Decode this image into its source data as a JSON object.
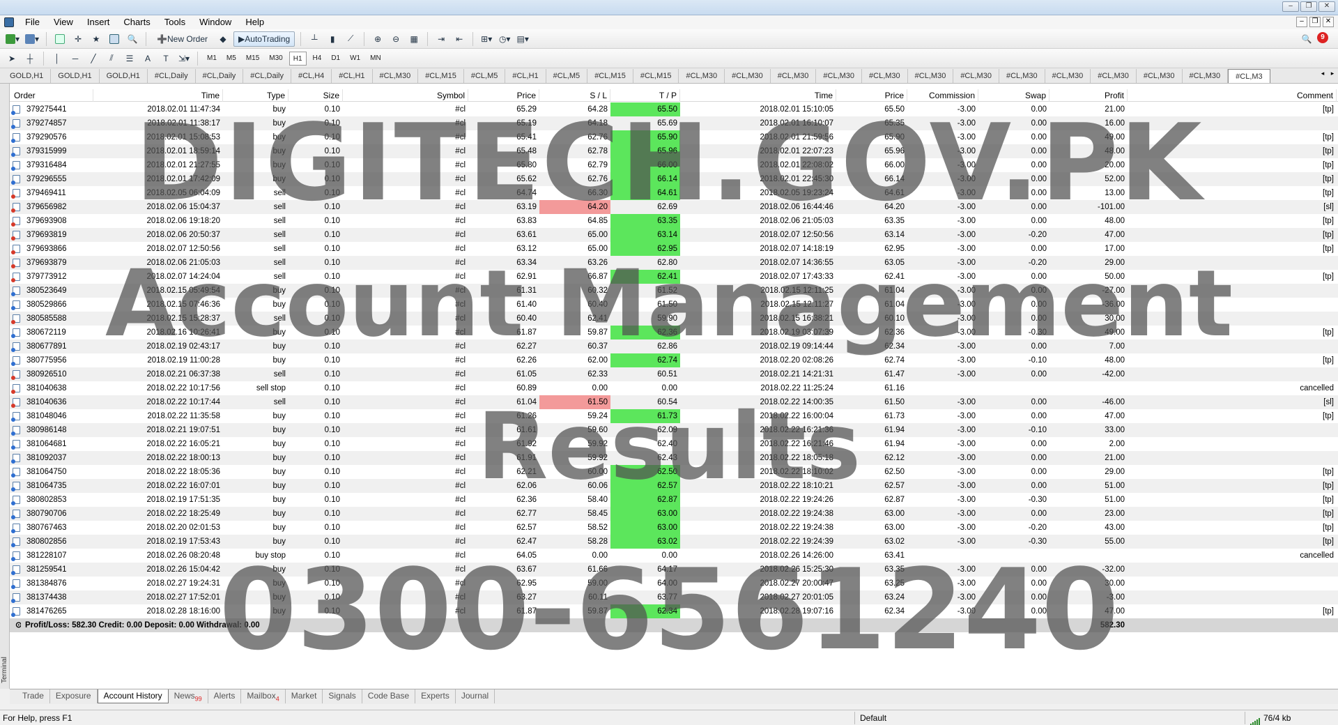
{
  "menu": [
    "File",
    "View",
    "Insert",
    "Charts",
    "Tools",
    "Window",
    "Help"
  ],
  "toolbar": {
    "new_order": "New Order",
    "autotrading": "AutoTrading",
    "notifications": "9"
  },
  "timeframes": [
    "M1",
    "M5",
    "M15",
    "M30",
    "H1",
    "H4",
    "D1",
    "W1",
    "MN"
  ],
  "active_timeframe": "H1",
  "chart_tabs": [
    "GOLD,H1",
    "GOLD,H1",
    "GOLD,H1",
    "#CL,Daily",
    "#CL,Daily",
    "#CL,Daily",
    "#CL,H4",
    "#CL,H1",
    "#CL,M30",
    "#CL,M15",
    "#CL,M5",
    "#CL,H1",
    "#CL,M5",
    "#CL,M15",
    "#CL,M15",
    "#CL,M30",
    "#CL,M30",
    "#CL,M30",
    "#CL,M30",
    "#CL,M30",
    "#CL,M30",
    "#CL,M30",
    "#CL,M30",
    "#CL,M30",
    "#CL,M30",
    "#CL,M30",
    "#CL,M30",
    "#CL,M3"
  ],
  "columns": [
    "Order",
    "Time",
    "Type",
    "Size",
    "Symbol",
    "Price",
    "S / L",
    "T / P",
    "Time",
    "Price",
    "Commission",
    "Swap",
    "Profit",
    "Comment"
  ],
  "rows": [
    {
      "order": "379275441",
      "time": "2018.02.01 11:47:34",
      "type": "buy",
      "size": "0.10",
      "symbol": "#cl",
      "price": "65.29",
      "sl": "64.28",
      "tp": "65.50",
      "ctime": "2018.02.01 15:10:05",
      "cprice": "65.50",
      "commission": "-3.00",
      "swap": "0.00",
      "profit": "21.00",
      "comment": "[tp]",
      "hl": "tp"
    },
    {
      "order": "379274857",
      "time": "2018.02.01 11:38:17",
      "type": "buy",
      "size": "0.10",
      "symbol": "#cl",
      "price": "65.19",
      "sl": "64.18",
      "tp": "65.69",
      "ctime": "2018.02.01 16:10:07",
      "cprice": "65.35",
      "commission": "-3.00",
      "swap": "0.00",
      "profit": "16.00",
      "comment": "",
      "hl": ""
    },
    {
      "order": "379290576",
      "time": "2018.02.01 15:08:53",
      "type": "buy",
      "size": "0.10",
      "symbol": "#cl",
      "price": "65.41",
      "sl": "62.76",
      "tp": "65.90",
      "ctime": "2018.02.01 21:59:56",
      "cprice": "65.90",
      "commission": "-3.00",
      "swap": "0.00",
      "profit": "49.00",
      "comment": "[tp]",
      "hl": "tp"
    },
    {
      "order": "379315999",
      "time": "2018.02.01 18:59:14",
      "type": "buy",
      "size": "0.10",
      "symbol": "#cl",
      "price": "65.48",
      "sl": "62.78",
      "tp": "65.96",
      "ctime": "2018.02.01 22:07:23",
      "cprice": "65.96",
      "commission": "-3.00",
      "swap": "0.00",
      "profit": "48.00",
      "comment": "[tp]",
      "hl": "tp"
    },
    {
      "order": "379316484",
      "time": "2018.02.01 21:27:55",
      "type": "buy",
      "size": "0.10",
      "symbol": "#cl",
      "price": "65.80",
      "sl": "62.79",
      "tp": "66.00",
      "ctime": "2018.02.01 22:08:02",
      "cprice": "66.00",
      "commission": "-3.00",
      "swap": "0.00",
      "profit": "20.00",
      "comment": "[tp]",
      "hl": "tp"
    },
    {
      "order": "379296555",
      "time": "2018.02.01 17:42:09",
      "type": "buy",
      "size": "0.10",
      "symbol": "#cl",
      "price": "65.62",
      "sl": "62.76",
      "tp": "66.14",
      "ctime": "2018.02.01 22:45:30",
      "cprice": "66.14",
      "commission": "-3.00",
      "swap": "0.00",
      "profit": "52.00",
      "comment": "[tp]",
      "hl": "tp"
    },
    {
      "order": "379469411",
      "time": "2018.02.05 06:04:09",
      "type": "sell",
      "size": "0.10",
      "symbol": "#cl",
      "price": "64.74",
      "sl": "66.30",
      "tp": "64.61",
      "ctime": "2018.02.05 19:23:24",
      "cprice": "64.61",
      "commission": "-3.00",
      "swap": "0.00",
      "profit": "13.00",
      "comment": "[tp]",
      "hl": "tp"
    },
    {
      "order": "379656982",
      "time": "2018.02.06 15:04:37",
      "type": "sell",
      "size": "0.10",
      "symbol": "#cl",
      "price": "63.19",
      "sl": "64.20",
      "tp": "62.69",
      "ctime": "2018.02.06 16:44:46",
      "cprice": "64.20",
      "commission": "-3.00",
      "swap": "0.00",
      "profit": "-101.00",
      "comment": "[sl]",
      "hl": "sl"
    },
    {
      "order": "379693908",
      "time": "2018.02.06 19:18:20",
      "type": "sell",
      "size": "0.10",
      "symbol": "#cl",
      "price": "63.83",
      "sl": "64.85",
      "tp": "63.35",
      "ctime": "2018.02.06 21:05:03",
      "cprice": "63.35",
      "commission": "-3.00",
      "swap": "0.00",
      "profit": "48.00",
      "comment": "[tp]",
      "hl": "tp"
    },
    {
      "order": "379693819",
      "time": "2018.02.06 20:50:37",
      "type": "sell",
      "size": "0.10",
      "symbol": "#cl",
      "price": "63.61",
      "sl": "65.00",
      "tp": "63.14",
      "ctime": "2018.02.07 12:50:56",
      "cprice": "63.14",
      "commission": "-3.00",
      "swap": "-0.20",
      "profit": "47.00",
      "comment": "[tp]",
      "hl": "tp"
    },
    {
      "order": "379693866",
      "time": "2018.02.07 12:50:56",
      "type": "sell",
      "size": "0.10",
      "symbol": "#cl",
      "price": "63.12",
      "sl": "65.00",
      "tp": "62.95",
      "ctime": "2018.02.07 14:18:19",
      "cprice": "62.95",
      "commission": "-3.00",
      "swap": "0.00",
      "profit": "17.00",
      "comment": "[tp]",
      "hl": "tp"
    },
    {
      "order": "379693879",
      "time": "2018.02.06 21:05:03",
      "type": "sell",
      "size": "0.10",
      "symbol": "#cl",
      "price": "63.34",
      "sl": "63.26",
      "tp": "62.80",
      "ctime": "2018.02.07 14:36:55",
      "cprice": "63.05",
      "commission": "-3.00",
      "swap": "-0.20",
      "profit": "29.00",
      "comment": "",
      "hl": ""
    },
    {
      "order": "379773912",
      "time": "2018.02.07 14:24:04",
      "type": "sell",
      "size": "0.10",
      "symbol": "#cl",
      "price": "62.91",
      "sl": "66.87",
      "tp": "62.41",
      "ctime": "2018.02.07 17:43:33",
      "cprice": "62.41",
      "commission": "-3.00",
      "swap": "0.00",
      "profit": "50.00",
      "comment": "[tp]",
      "hl": "tp"
    },
    {
      "order": "380523649",
      "time": "2018.02.15 05:49:54",
      "type": "buy",
      "size": "0.10",
      "symbol": "#cl",
      "price": "61.31",
      "sl": "60.32",
      "tp": "61.52",
      "ctime": "2018.02.15 12:11:25",
      "cprice": "61.04",
      "commission": "-3.00",
      "swap": "0.00",
      "profit": "-27.00",
      "comment": "",
      "hl": ""
    },
    {
      "order": "380529866",
      "time": "2018.02.15 07:46:36",
      "type": "buy",
      "size": "0.10",
      "symbol": "#cl",
      "price": "61.40",
      "sl": "60.40",
      "tp": "61.50",
      "ctime": "2018.02.15 12:11:27",
      "cprice": "61.04",
      "commission": "-3.00",
      "swap": "0.00",
      "profit": "-36.00",
      "comment": "",
      "hl": ""
    },
    {
      "order": "380585588",
      "time": "2018.02.15 15:28:37",
      "type": "sell",
      "size": "0.10",
      "symbol": "#cl",
      "price": "60.40",
      "sl": "62.41",
      "tp": "59.90",
      "ctime": "2018.02.15 16:38:21",
      "cprice": "60.10",
      "commission": "-3.00",
      "swap": "0.00",
      "profit": "30.00",
      "comment": "",
      "hl": ""
    },
    {
      "order": "380672119",
      "time": "2018.02.16 10:26:41",
      "type": "buy",
      "size": "0.10",
      "symbol": "#cl",
      "price": "61.87",
      "sl": "59.87",
      "tp": "62.36",
      "ctime": "2018.02.19 03:07:39",
      "cprice": "62.36",
      "commission": "-3.00",
      "swap": "-0.30",
      "profit": "49.00",
      "comment": "[tp]",
      "hl": "tp"
    },
    {
      "order": "380677891",
      "time": "2018.02.19 02:43:17",
      "type": "buy",
      "size": "0.10",
      "symbol": "#cl",
      "price": "62.27",
      "sl": "60.37",
      "tp": "62.86",
      "ctime": "2018.02.19 09:14:44",
      "cprice": "62.34",
      "commission": "-3.00",
      "swap": "0.00",
      "profit": "7.00",
      "comment": "",
      "hl": ""
    },
    {
      "order": "380775956",
      "time": "2018.02.19 11:00:28",
      "type": "buy",
      "size": "0.10",
      "symbol": "#cl",
      "price": "62.26",
      "sl": "62.00",
      "tp": "62.74",
      "ctime": "2018.02.20 02:08:26",
      "cprice": "62.74",
      "commission": "-3.00",
      "swap": "-0.10",
      "profit": "48.00",
      "comment": "[tp]",
      "hl": "tp"
    },
    {
      "order": "380926510",
      "time": "2018.02.21 06:37:38",
      "type": "sell",
      "size": "0.10",
      "symbol": "#cl",
      "price": "61.05",
      "sl": "62.33",
      "tp": "60.51",
      "ctime": "2018.02.21 14:21:31",
      "cprice": "61.47",
      "commission": "-3.00",
      "swap": "0.00",
      "profit": "-42.00",
      "comment": "",
      "hl": ""
    },
    {
      "order": "381040638",
      "time": "2018.02.22 10:17:56",
      "type": "sell stop",
      "size": "0.10",
      "symbol": "#cl",
      "price": "60.89",
      "sl": "0.00",
      "tp": "0.00",
      "ctime": "2018.02.22 11:25:24",
      "cprice": "61.16",
      "commission": "",
      "swap": "",
      "profit": "",
      "comment": "cancelled",
      "hl": ""
    },
    {
      "order": "381040636",
      "time": "2018.02.22 10:17:44",
      "type": "sell",
      "size": "0.10",
      "symbol": "#cl",
      "price": "61.04",
      "sl": "61.50",
      "tp": "60.54",
      "ctime": "2018.02.22 14:00:35",
      "cprice": "61.50",
      "commission": "-3.00",
      "swap": "0.00",
      "profit": "-46.00",
      "comment": "[sl]",
      "hl": "sl"
    },
    {
      "order": "381048046",
      "time": "2018.02.22 11:35:58",
      "type": "buy",
      "size": "0.10",
      "symbol": "#cl",
      "price": "61.26",
      "sl": "59.24",
      "tp": "61.73",
      "ctime": "2018.02.22 16:00:04",
      "cprice": "61.73",
      "commission": "-3.00",
      "swap": "0.00",
      "profit": "47.00",
      "comment": "[tp]",
      "hl": "tp"
    },
    {
      "order": "380986148",
      "time": "2018.02.21 19:07:51",
      "type": "buy",
      "size": "0.10",
      "symbol": "#cl",
      "price": "61.61",
      "sl": "59.60",
      "tp": "62.09",
      "ctime": "2018.02.22 16:21:36",
      "cprice": "61.94",
      "commission": "-3.00",
      "swap": "-0.10",
      "profit": "33.00",
      "comment": "",
      "hl": ""
    },
    {
      "order": "381064681",
      "time": "2018.02.22 16:05:21",
      "type": "buy",
      "size": "0.10",
      "symbol": "#cl",
      "price": "61.92",
      "sl": "59.92",
      "tp": "62.40",
      "ctime": "2018.02.22 16:21:46",
      "cprice": "61.94",
      "commission": "-3.00",
      "swap": "0.00",
      "profit": "2.00",
      "comment": "",
      "hl": ""
    },
    {
      "order": "381092037",
      "time": "2018.02.22 18:00:13",
      "type": "buy",
      "size": "0.10",
      "symbol": "#cl",
      "price": "61.91",
      "sl": "59.92",
      "tp": "62.43",
      "ctime": "2018.02.22 18:05:18",
      "cprice": "62.12",
      "commission": "-3.00",
      "swap": "0.00",
      "profit": "21.00",
      "comment": "",
      "hl": ""
    },
    {
      "order": "381064750",
      "time": "2018.02.22 18:05:36",
      "type": "buy",
      "size": "0.10",
      "symbol": "#cl",
      "price": "62.21",
      "sl": "60.00",
      "tp": "62.50",
      "ctime": "2018.02.22 18:10:02",
      "cprice": "62.50",
      "commission": "-3.00",
      "swap": "0.00",
      "profit": "29.00",
      "comment": "[tp]",
      "hl": "tp"
    },
    {
      "order": "381064735",
      "time": "2018.02.22 16:07:01",
      "type": "buy",
      "size": "0.10",
      "symbol": "#cl",
      "price": "62.06",
      "sl": "60.06",
      "tp": "62.57",
      "ctime": "2018.02.22 18:10:21",
      "cprice": "62.57",
      "commission": "-3.00",
      "swap": "0.00",
      "profit": "51.00",
      "comment": "[tp]",
      "hl": "tp"
    },
    {
      "order": "380802853",
      "time": "2018.02.19 17:51:35",
      "type": "buy",
      "size": "0.10",
      "symbol": "#cl",
      "price": "62.36",
      "sl": "58.40",
      "tp": "62.87",
      "ctime": "2018.02.22 19:24:26",
      "cprice": "62.87",
      "commission": "-3.00",
      "swap": "-0.30",
      "profit": "51.00",
      "comment": "[tp]",
      "hl": "tp"
    },
    {
      "order": "380790706",
      "time": "2018.02.22 18:25:49",
      "type": "buy",
      "size": "0.10",
      "symbol": "#cl",
      "price": "62.77",
      "sl": "58.45",
      "tp": "63.00",
      "ctime": "2018.02.22 19:24:38",
      "cprice": "63.00",
      "commission": "-3.00",
      "swap": "0.00",
      "profit": "23.00",
      "comment": "[tp]",
      "hl": "tp"
    },
    {
      "order": "380767463",
      "time": "2018.02.20 02:01:53",
      "type": "buy",
      "size": "0.10",
      "symbol": "#cl",
      "price": "62.57",
      "sl": "58.52",
      "tp": "63.00",
      "ctime": "2018.02.22 19:24:38",
      "cprice": "63.00",
      "commission": "-3.00",
      "swap": "-0.20",
      "profit": "43.00",
      "comment": "[tp]",
      "hl": "tp"
    },
    {
      "order": "380802856",
      "time": "2018.02.19 17:53:43",
      "type": "buy",
      "size": "0.10",
      "symbol": "#cl",
      "price": "62.47",
      "sl": "58.28",
      "tp": "63.02",
      "ctime": "2018.02.22 19:24:39",
      "cprice": "63.02",
      "commission": "-3.00",
      "swap": "-0.30",
      "profit": "55.00",
      "comment": "[tp]",
      "hl": "tp"
    },
    {
      "order": "381228107",
      "time": "2018.02.26 08:20:48",
      "type": "buy stop",
      "size": "0.10",
      "symbol": "#cl",
      "price": "64.05",
      "sl": "0.00",
      "tp": "0.00",
      "ctime": "2018.02.26 14:26:00",
      "cprice": "63.41",
      "commission": "",
      "swap": "",
      "profit": "",
      "comment": "cancelled",
      "hl": ""
    },
    {
      "order": "381259541",
      "time": "2018.02.26 15:04:42",
      "type": "buy",
      "size": "0.10",
      "symbol": "#cl",
      "price": "63.67",
      "sl": "61.66",
      "tp": "64.17",
      "ctime": "2018.02.26 15:25:30",
      "cprice": "63.35",
      "commission": "-3.00",
      "swap": "0.00",
      "profit": "-32.00",
      "comment": "",
      "hl": ""
    },
    {
      "order": "381384876",
      "time": "2018.02.27 19:24:31",
      "type": "buy",
      "size": "0.10",
      "symbol": "#cl",
      "price": "62.95",
      "sl": "59.00",
      "tp": "64.00",
      "ctime": "2018.02.27 20:00:47",
      "cprice": "63.25",
      "commission": "-3.00",
      "swap": "0.00",
      "profit": "30.00",
      "comment": "",
      "hl": ""
    },
    {
      "order": "381374438",
      "time": "2018.02.27 17:52:01",
      "type": "buy",
      "size": "0.10",
      "symbol": "#cl",
      "price": "63.27",
      "sl": "60.11",
      "tp": "63.77",
      "ctime": "2018.02.27 20:01:05",
      "cprice": "63.24",
      "commission": "-3.00",
      "swap": "0.00",
      "profit": "-3.00",
      "comment": "",
      "hl": ""
    },
    {
      "order": "381476265",
      "time": "2018.02.28 18:16:00",
      "type": "buy",
      "size": "0.10",
      "symbol": "#cl",
      "price": "61.87",
      "sl": "59.87",
      "tp": "62.34",
      "ctime": "2018.02.28 19:07:16",
      "cprice": "62.34",
      "commission": "-3.00",
      "swap": "0.00",
      "profit": "47.00",
      "comment": "[tp]",
      "hl": "tp"
    }
  ],
  "summary": {
    "text": "Profit/Loss: 582.30  Credit: 0.00  Deposit: 0.00  Withdrawal: 0.00",
    "total": "582.30"
  },
  "bottom_tabs": [
    {
      "label": "Trade",
      "badge": ""
    },
    {
      "label": "Exposure",
      "badge": ""
    },
    {
      "label": "Account History",
      "badge": ""
    },
    {
      "label": "News",
      "badge": "99"
    },
    {
      "label": "Alerts",
      "badge": ""
    },
    {
      "label": "Mailbox",
      "badge": "4"
    },
    {
      "label": "Market",
      "badge": ""
    },
    {
      "label": "Signals",
      "badge": ""
    },
    {
      "label": "Code Base",
      "badge": ""
    },
    {
      "label": "Experts",
      "badge": ""
    },
    {
      "label": "Journal",
      "badge": ""
    }
  ],
  "active_bottom_tab": "Account History",
  "terminal_label": "Terminal",
  "status": {
    "help": "For Help, press F1",
    "profile": "Default",
    "traffic": "76/4 kb"
  },
  "watermark": [
    "DIGITECH.GOV.PK",
    "Account Management",
    "Results",
    "0300-6561240"
  ],
  "colors": {
    "tp_highlight": "#5ce65c",
    "sl_highlight": "#f39a9a",
    "summary_bg": "#d6d6d6",
    "buy_icon": "#2f6fd1",
    "sell_icon": "#d63a2a"
  }
}
